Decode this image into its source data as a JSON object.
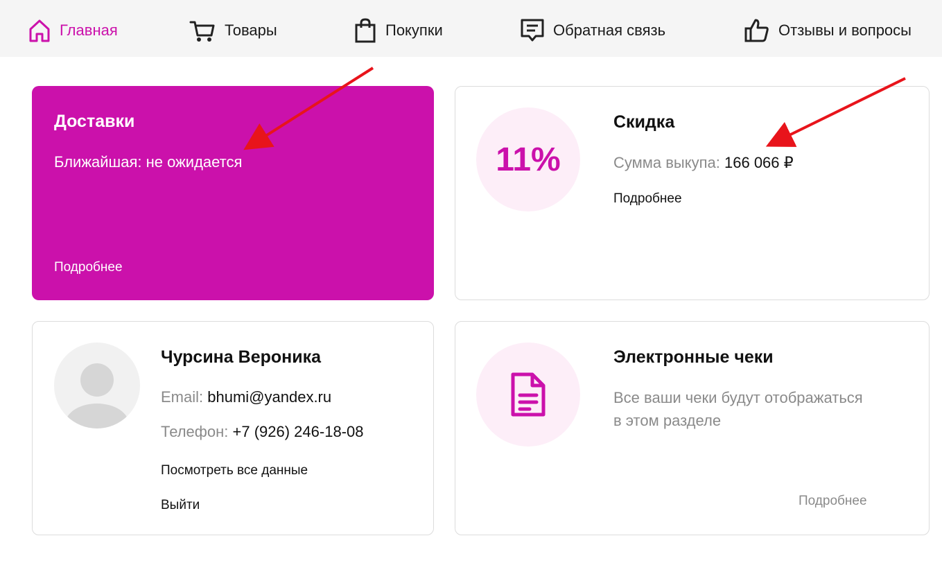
{
  "nav": {
    "home": "Главная",
    "goods": "Товары",
    "purchases": "Покупки",
    "feedback": "Обратная связь",
    "reviews": "Отзывы и вопросы"
  },
  "delivery": {
    "title": "Доставки",
    "nearest": "Ближайшая: не ожидается",
    "more": "Подробнее"
  },
  "discount": {
    "percent": "11%",
    "title": "Скидка",
    "sum_label": "Сумма выкупа:",
    "sum_value": "166 066 ₽",
    "more": "Подробнее"
  },
  "profile": {
    "name": "Чурсина Вероника",
    "email_label": "Email:",
    "email_value": "bhumi@yandex.ru",
    "phone_label": "Телефон:",
    "phone_value": "+7 (926) 246-18-08",
    "view_all": "Посмотреть все данные",
    "logout": "Выйти"
  },
  "receipts": {
    "title": "Электронные чеки",
    "desc_line1": "Все ваши чеки будут отображаться",
    "desc_line2": "в этом разделе",
    "more": "Подробнее"
  },
  "colors": {
    "accent": "#cb11ab",
    "accent_light": "#fdeef8",
    "annotation": "#e8141b"
  }
}
